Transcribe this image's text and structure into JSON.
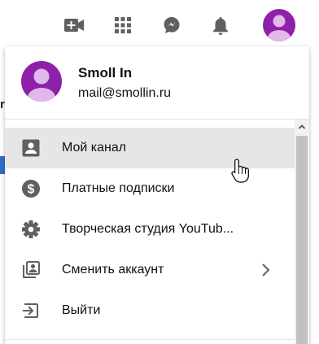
{
  "colors": {
    "avatar_bg": "#8d22a9",
    "avatar_person": "#e2b8ea",
    "icon_gray": "#606060",
    "active_row": "#e6e6e6",
    "left_bar": "#2f6ec6"
  },
  "topbar": {
    "icons": [
      "video-camera-plus-icon",
      "apps-grid-icon",
      "messages-icon",
      "bell-icon"
    ],
    "left_edge_text": "re"
  },
  "account": {
    "name": "Smoll In",
    "email": "mail@smollin.ru"
  },
  "menu": {
    "items": [
      {
        "label": "Мой канал",
        "icon": "person-box-icon",
        "active": true
      },
      {
        "label": "Платные подписки",
        "icon": "dollar-circle-icon"
      },
      {
        "label": "Творческая студия YouTub...",
        "icon": "gear-icon"
      },
      {
        "label": "Сменить аккаунт",
        "icon": "switch-account-icon",
        "chevron": true
      },
      {
        "label": "Выйти",
        "icon": "sign-out-icon"
      }
    ]
  }
}
